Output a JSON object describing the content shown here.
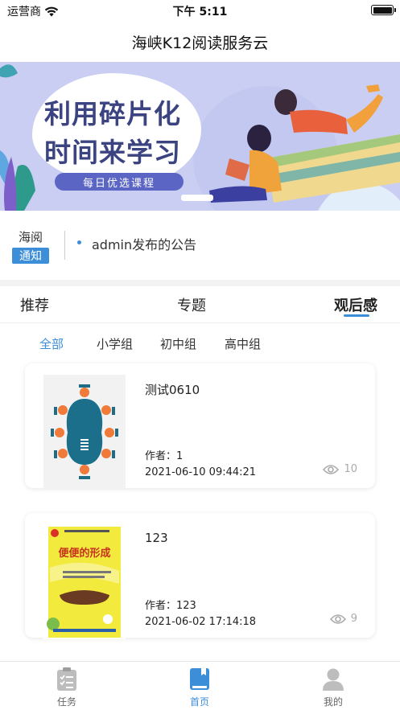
{
  "status_bar": {
    "carrier": "运营商",
    "time": "下午 5:11"
  },
  "nav": {
    "title": "海峡K12阅读服务云"
  },
  "banner": {
    "line1": "利用碎片化",
    "line2": "时间来学习",
    "pill": "每日优选课程"
  },
  "notice": {
    "brand_top": "海阅",
    "brand_badge": "通知",
    "text": "admin发布的公告"
  },
  "tabs": [
    {
      "label": "推荐",
      "active": false
    },
    {
      "label": "专题",
      "active": false
    },
    {
      "label": "观后感",
      "active": true
    }
  ],
  "filters": [
    {
      "label": "全部",
      "active": true
    },
    {
      "label": "小学组",
      "active": false
    },
    {
      "label": "初中组",
      "active": false
    },
    {
      "label": "高中组",
      "active": false
    }
  ],
  "cards": [
    {
      "title": "测试0610",
      "author": "作者：1",
      "date": "2021-06-10 09:44:21",
      "views": "10"
    },
    {
      "title": "123",
      "author": "作者：123",
      "date": "2021-06-02 17:14:18",
      "views": "9",
      "cover_title": "便便的形成"
    }
  ],
  "tabbar": [
    {
      "label": "任务",
      "icon": "task-icon",
      "active": false
    },
    {
      "label": "首页",
      "icon": "home-book-icon",
      "active": true
    },
    {
      "label": "我的",
      "icon": "profile-icon",
      "active": false
    }
  ],
  "colors": {
    "accent": "#3d8ed9",
    "banner_bg": "#c9cef2",
    "banner_title": "#3b4380"
  }
}
